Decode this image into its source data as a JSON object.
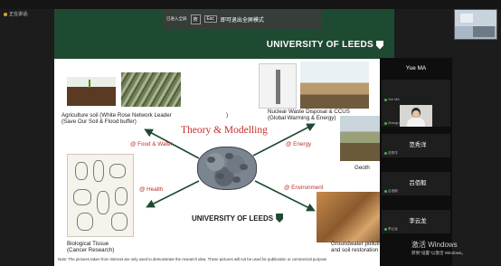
{
  "meeting": {
    "presenter_label": "正在讲话:",
    "fullscreen_bar": {
      "hint": "已进入全屏",
      "key_f": "按",
      "key_esc": "Esc",
      "key_esc_sub": "Esc",
      "exit_text": "即可退出全屏模式"
    }
  },
  "slide": {
    "university_top": "UNIVERSITY OF LEEDS",
    "university_mid": "UNIVERSITY OF LEEDS",
    "theory": "Theory & Modelling",
    "agri_line1": "Agriculture soil (White Rose Network Leader",
    "agri_line2": "(Save Our Soil & Flood buffer)",
    "agri_paren": ")",
    "nuclear_line1": "Nuclear Waste Disposal & CCUS",
    "nuclear_line2": "(Global Warming & Energy)",
    "geothermal": "Geoth",
    "bio_line1": "Biological Tissue",
    "bio_line2": "(Cancer Research)",
    "ground_line1": "Groundwater pollution",
    "ground_line2": "and soil restoration",
    "tag_food": "@ Food & Water",
    "tag_energy": "@ Energy",
    "tag_health": "@ Health",
    "tag_env": "@ Environment",
    "note": "Note: The pictures taken from internet are only used to demonstrate the research idea. These pictures will not be used for publication or commercial purpose"
  },
  "participants": {
    "header_name": "Yue MA",
    "list": [
      {
        "name": "",
        "small": "Yue MA"
      },
      {
        "name": "",
        "small": "ZhangLei"
      },
      {
        "name": "范秀洋",
        "small": "范秀洋"
      },
      {
        "name": "吕佰毅",
        "small": "吕佰毅"
      },
      {
        "name": "李云龙",
        "small": "李云龙"
      }
    ]
  },
  "watermark": {
    "line1": "激活 Windows",
    "line2": "转到\"设置\"以激活 Windows。"
  },
  "colors": {
    "leeds_green": "#1f4a32",
    "accent_red": "#c0302a",
    "arrow": "#1f4a32"
  }
}
